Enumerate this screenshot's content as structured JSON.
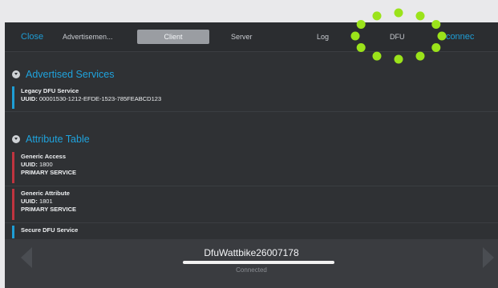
{
  "toolbar": {
    "close_label": "Close",
    "tabs": [
      "Advertisemen...",
      "Client",
      "Server",
      "Log",
      "DFU"
    ],
    "active_tab": "Client",
    "disconnect_label": "Disconnect",
    "disconnect_visible_text": "isconnec",
    "highlight_color": "#9be31a"
  },
  "advertised": {
    "title": "Advertised Services",
    "items": [
      {
        "name": "Legacy DFU Service",
        "uuid_label": "UUID:",
        "uuid": "00001530-1212-EFDE-1523-785FEABCD123",
        "color": "#1e9ed6"
      }
    ]
  },
  "attributes": {
    "title": "Attribute Table",
    "items": [
      {
        "name": "Generic Access",
        "uuid_label": "UUID:",
        "uuid": "1800",
        "type": "PRIMARY SERVICE",
        "color": "#c0343f"
      },
      {
        "name": "Generic Attribute",
        "uuid_label": "UUID:",
        "uuid": "1801",
        "type": "PRIMARY SERVICE",
        "color": "#c0343f"
      },
      {
        "name": "Secure DFU Service",
        "color": "#1e9ed6"
      }
    ]
  },
  "device": {
    "name": "DfuWattbike26007178",
    "status": "Connected"
  }
}
